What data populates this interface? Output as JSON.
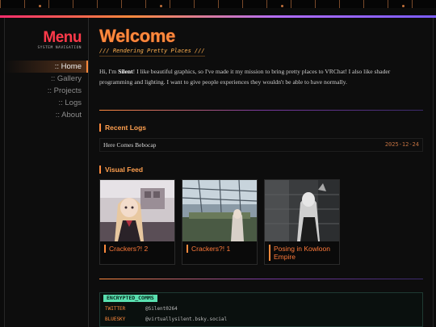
{
  "sidebar": {
    "title": "Menu",
    "subtitle": "SYSTEM NAVIGATION",
    "items": [
      {
        "label": ":: Home",
        "active": true
      },
      {
        "label": ":: Gallery",
        "active": false
      },
      {
        "label": ":: Projects",
        "active": false
      },
      {
        "label": ":: Logs",
        "active": false
      },
      {
        "label": ":: About",
        "active": false
      }
    ]
  },
  "main": {
    "title": "Welcome",
    "subtitle": "/// Rendering Pretty Places ///",
    "intro": {
      "before": "Hi, I'm ",
      "name": "Silent",
      "after": "! I like beautiful graphics, so I've made it my mission to bring pretty places to VRChat! I also like shader programming and lighting. I want to give people experiences they wouldn't be able to have normally."
    }
  },
  "recent_logs": {
    "title": "Recent Logs",
    "entries": [
      {
        "title": "Here Comes Bebocap",
        "date": "2025-12-24"
      }
    ]
  },
  "visual_feed": {
    "title": "Visual Feed",
    "cards": [
      {
        "caption": "Crackers?! 2"
      },
      {
        "caption": "Crackers?! 1"
      },
      {
        "caption": "Posing in Kowloon Empire"
      }
    ]
  },
  "comms": {
    "title": "ENCRYPTED_COMMS",
    "rows": [
      {
        "key": "TWITTER",
        "value": "@Silent0264"
      },
      {
        "key": "BLUESKY",
        "value": "@virtuallysilent.bsky.social"
      }
    ]
  },
  "colors": {
    "accent": "#ff8a3d",
    "menu_red": "#ff3a4a",
    "comms_green": "#5ae0b0",
    "background": "#0d0d0d"
  }
}
